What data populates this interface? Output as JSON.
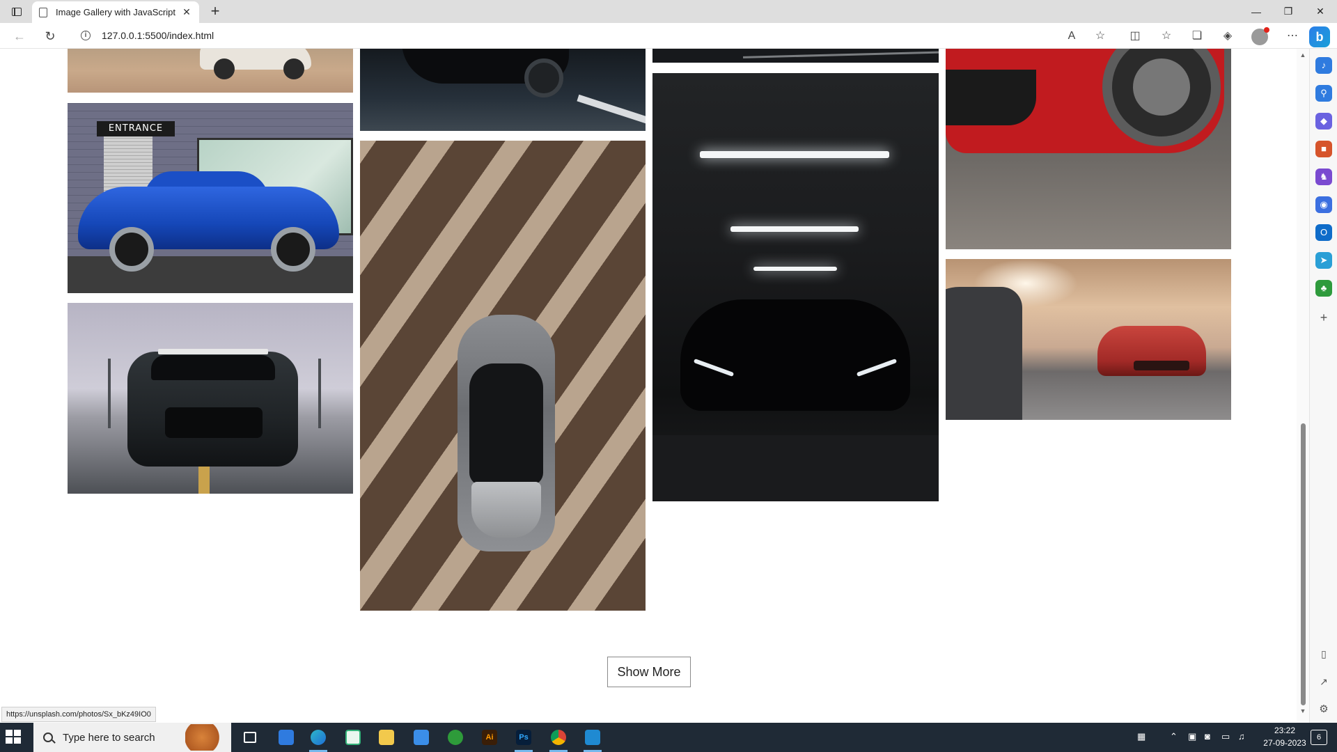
{
  "browser": {
    "tab_title": "Image Gallery with JavaScript | C",
    "tab_close": "✕",
    "new_tab": "+",
    "url": "127.0.0.1:5500/index.html",
    "window_controls": {
      "minimize": "—",
      "maximize": "❐",
      "close": "✕"
    },
    "nav": {
      "back": "←",
      "refresh": "↻"
    },
    "toolbar_icons": {
      "read_aloud": "A",
      "favorite": "☆",
      "split": "◫",
      "favorites": "☆",
      "collections": "❏",
      "extensions": "◈",
      "more": "⋯"
    },
    "bing": "b"
  },
  "gallery": {
    "sign_text": "ENTRANCE",
    "show_more_label": "Show More"
  },
  "status_link": "https://unsplash.com/photos/Sx_bKz49IO0",
  "sidebar": {
    "icons": [
      "bell-icon",
      "search-icon",
      "tag-icon",
      "briefcase-icon",
      "chess-icon",
      "office-icon",
      "outlook-icon",
      "send-icon",
      "tree-icon"
    ],
    "add": "+",
    "bottom": [
      "panel-icon",
      "external-icon",
      "settings-icon"
    ]
  },
  "taskbar": {
    "search_placeholder": "Type here to search",
    "apps": [
      "task-view",
      "store",
      "edge",
      "notepad",
      "explorer",
      "mail",
      "xbox",
      "illustrator",
      "photoshop",
      "chrome",
      "vscode"
    ],
    "illustrator_label": "Ai",
    "photoshop_label": "Ps",
    "time": "23:22",
    "date": "27-09-2023",
    "notifications": "6"
  },
  "colors": {
    "taskbar_bg": "#1f2a36",
    "tab_strip_bg": "#dedede",
    "accent": "#76b9ed"
  }
}
